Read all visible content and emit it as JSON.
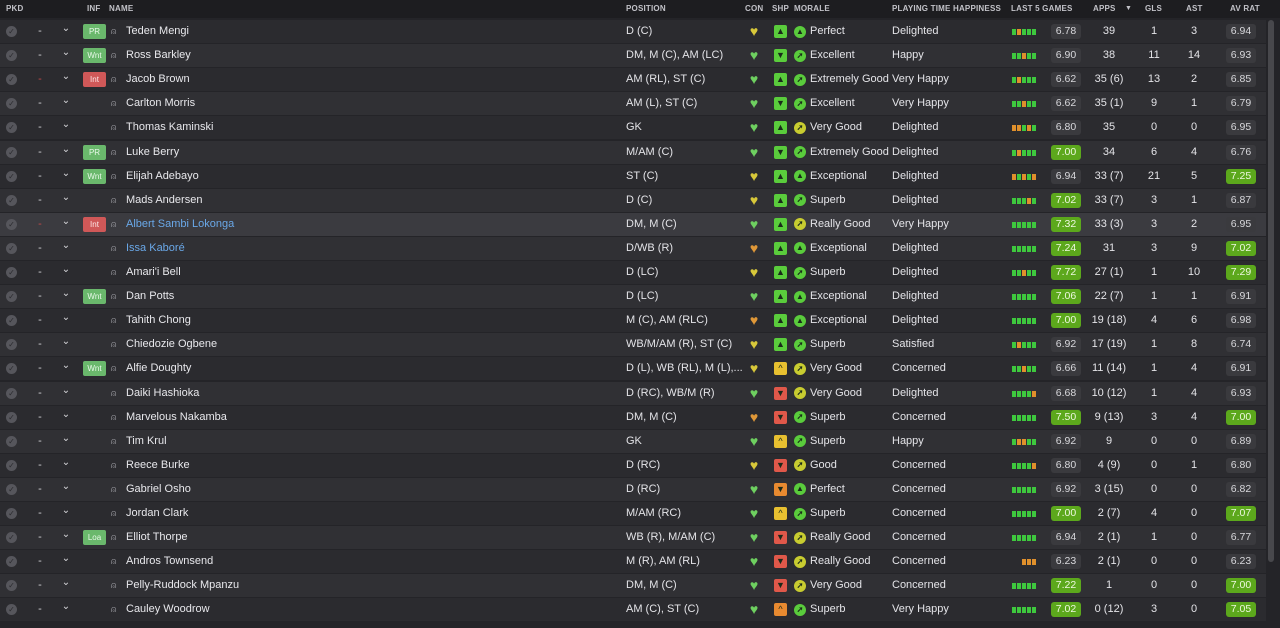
{
  "headers": {
    "pkd": "PKD",
    "inf": "INF",
    "name": "NAME",
    "position": "POSITION",
    "con": "CON",
    "shp": "SHP",
    "morale": "MORALE",
    "playing_time": "PLAYING TIME HAPPINESS",
    "last5": "LAST 5 GAMES",
    "apps": "APPS",
    "gls": "GLS",
    "ast": "AST",
    "avrat": "AV RAT",
    "sort_icon": "sort-desc-icon"
  },
  "colors": {
    "form_green": "#3ec83e",
    "form_orange": "#e0902c",
    "form_yellow": "#c8c844",
    "pill_green": "#5ca81c",
    "badge_green": "#6ab86c",
    "badge_red": "#d05858",
    "link_blue": "#6aa8e8",
    "heart_green": "#6ed060",
    "heart_yellow": "#d8c83a",
    "heart_orange": "#e09838",
    "shp_green": "#5acc3c",
    "shp_yellow": "#e8c030",
    "shp_orange": "#e88a30",
    "shp_red": "#e0584a",
    "morale_green": "#5acc3c",
    "morale_yellow": "#c8cc30"
  },
  "players": [
    {
      "dash": "-",
      "dash_red": false,
      "inf": "PR",
      "inf_color": "g",
      "name": "Teden Mengi",
      "link": false,
      "position": "D (C)",
      "con": "yellow",
      "shp": "green",
      "shp_icon": "up",
      "mor": "green",
      "mor_icon": "up",
      "morale": "Perfect",
      "pt": "Delighted",
      "form": [
        "g",
        "o",
        "g",
        "g",
        "g"
      ],
      "last5": "6.78",
      "last5_hi": false,
      "apps": "39",
      "gls": "1",
      "ast": "3",
      "avrat": "6.94",
      "avrat_hi": false
    },
    {
      "dash": "-",
      "dash_red": false,
      "inf": "Wnt",
      "inf_color": "g",
      "name": "Ross Barkley",
      "link": false,
      "position": "DM, M (C), AM (LC)",
      "con": "green",
      "shp": "green",
      "shp_icon": "down",
      "mor": "green",
      "mor_icon": "right",
      "morale": "Excellent",
      "pt": "Happy",
      "form": [
        "g",
        "g",
        "o",
        "g",
        "g"
      ],
      "last5": "6.90",
      "last5_hi": false,
      "apps": "38",
      "gls": "11",
      "ast": "14",
      "avrat": "6.93",
      "avrat_hi": false
    },
    {
      "dash": "-",
      "dash_red": true,
      "inf": "Int",
      "inf_color": "r",
      "name": "Jacob Brown",
      "link": false,
      "position": "AM (RL), ST (C)",
      "con": "green",
      "shp": "green",
      "shp_icon": "up",
      "mor": "green",
      "mor_icon": "right",
      "morale": "Extremely Good",
      "pt": "Very Happy",
      "form": [
        "g",
        "o",
        "g",
        "g",
        "g"
      ],
      "last5": "6.62",
      "last5_hi": false,
      "apps": "35 (6)",
      "gls": "13",
      "ast": "2",
      "avrat": "6.85",
      "avrat_hi": false
    },
    {
      "dash": "-",
      "dash_red": false,
      "inf": "",
      "inf_color": "",
      "name": "Carlton Morris",
      "link": false,
      "position": "AM (L), ST (C)",
      "con": "green",
      "shp": "green",
      "shp_icon": "down",
      "mor": "green",
      "mor_icon": "right",
      "morale": "Excellent",
      "pt": "Very Happy",
      "form": [
        "g",
        "g",
        "o",
        "g",
        "g"
      ],
      "last5": "6.62",
      "last5_hi": false,
      "apps": "35 (1)",
      "gls": "9",
      "ast": "1",
      "avrat": "6.79",
      "avrat_hi": false
    },
    {
      "dash": "-",
      "dash_red": false,
      "inf": "",
      "inf_color": "",
      "name": "Thomas Kaminski",
      "link": false,
      "position": "GK",
      "con": "green",
      "shp": "green",
      "shp_icon": "up",
      "mor": "yellow",
      "mor_icon": "right",
      "morale": "Very Good",
      "pt": "Delighted",
      "form": [
        "o",
        "o",
        "g",
        "o",
        "g"
      ],
      "last5": "6.80",
      "last5_hi": false,
      "apps": "35",
      "gls": "0",
      "ast": "0",
      "avrat": "6.95",
      "avrat_hi": false
    },
    {
      "dash": "-",
      "dash_red": false,
      "inf": "PR",
      "inf_color": "g",
      "name": "Luke Berry",
      "link": false,
      "position": "M/AM (C)",
      "con": "green",
      "shp": "green",
      "shp_icon": "down",
      "mor": "green",
      "mor_icon": "right",
      "morale": "Extremely Good",
      "pt": "Delighted",
      "form": [
        "g",
        "o",
        "g",
        "g",
        "g"
      ],
      "last5": "7.00",
      "last5_hi": true,
      "apps": "34",
      "gls": "6",
      "ast": "4",
      "avrat": "6.76",
      "avrat_hi": false
    },
    {
      "dash": "-",
      "dash_red": false,
      "inf": "Wnt",
      "inf_color": "g",
      "name": "Elijah Adebayo",
      "link": false,
      "position": "ST (C)",
      "con": "yellow",
      "shp": "green",
      "shp_icon": "up",
      "mor": "green",
      "mor_icon": "up",
      "morale": "Exceptional",
      "pt": "Delighted",
      "form": [
        "o",
        "g",
        "o",
        "g",
        "o"
      ],
      "last5": "6.94",
      "last5_hi": false,
      "apps": "33 (7)",
      "gls": "21",
      "ast": "5",
      "avrat": "7.25",
      "avrat_hi": true
    },
    {
      "dash": "-",
      "dash_red": false,
      "inf": "",
      "inf_color": "",
      "name": "Mads Andersen",
      "link": false,
      "position": "D (C)",
      "con": "yellow",
      "shp": "green",
      "shp_icon": "up",
      "mor": "green",
      "mor_icon": "right",
      "morale": "Superb",
      "pt": "Delighted",
      "form": [
        "g",
        "g",
        "g",
        "o",
        "g"
      ],
      "last5": "7.02",
      "last5_hi": true,
      "apps": "33 (7)",
      "gls": "3",
      "ast": "1",
      "avrat": "6.87",
      "avrat_hi": false
    },
    {
      "dash": "-",
      "dash_red": true,
      "inf": "Int",
      "inf_color": "r",
      "name": "Albert Sambi Lokonga",
      "link": true,
      "position": "DM, M (C)",
      "con": "green",
      "shp": "green",
      "shp_icon": "up",
      "mor": "yellow",
      "mor_icon": "right",
      "morale": "Really Good",
      "pt": "Very Happy",
      "form": [
        "g",
        "g",
        "g",
        "g",
        "g"
      ],
      "last5": "7.32",
      "last5_hi": true,
      "apps": "33 (3)",
      "gls": "3",
      "ast": "2",
      "avrat": "6.95",
      "avrat_hi": false
    },
    {
      "dash": "-",
      "dash_red": false,
      "inf": "",
      "inf_color": "",
      "name": "Issa Kaboré",
      "link": true,
      "position": "D/WB (R)",
      "con": "orange",
      "shp": "green",
      "shp_icon": "up",
      "mor": "green",
      "mor_icon": "up",
      "morale": "Exceptional",
      "pt": "Delighted",
      "form": [
        "g",
        "g",
        "g",
        "g",
        "g"
      ],
      "last5": "7.24",
      "last5_hi": true,
      "apps": "31",
      "gls": "3",
      "ast": "9",
      "avrat": "7.02",
      "avrat_hi": true
    },
    {
      "dash": "-",
      "dash_red": false,
      "inf": "",
      "inf_color": "",
      "name": "Amari'i Bell",
      "link": false,
      "position": "D (LC)",
      "con": "yellow",
      "shp": "green",
      "shp_icon": "up",
      "mor": "green",
      "mor_icon": "right",
      "morale": "Superb",
      "pt": "Delighted",
      "form": [
        "g",
        "g",
        "o",
        "g",
        "g"
      ],
      "last5": "7.72",
      "last5_hi": true,
      "apps": "27 (1)",
      "gls": "1",
      "ast": "10",
      "avrat": "7.29",
      "avrat_hi": true
    },
    {
      "dash": "-",
      "dash_red": false,
      "inf": "Wnt",
      "inf_color": "g",
      "name": "Dan Potts",
      "link": false,
      "position": "D (LC)",
      "con": "green",
      "shp": "green",
      "shp_icon": "up",
      "mor": "green",
      "mor_icon": "up",
      "morale": "Exceptional",
      "pt": "Delighted",
      "form": [
        "g",
        "g",
        "g",
        "g",
        "g"
      ],
      "last5": "7.06",
      "last5_hi": true,
      "apps": "22 (7)",
      "gls": "1",
      "ast": "1",
      "avrat": "6.91",
      "avrat_hi": false
    },
    {
      "dash": "-",
      "dash_red": false,
      "inf": "",
      "inf_color": "",
      "name": "Tahith Chong",
      "link": false,
      "position": "M (C), AM (RLC)",
      "con": "orange",
      "shp": "green",
      "shp_icon": "up",
      "mor": "green",
      "mor_icon": "up",
      "morale": "Exceptional",
      "pt": "Delighted",
      "form": [
        "g",
        "g",
        "g",
        "g",
        "g"
      ],
      "last5": "7.00",
      "last5_hi": true,
      "apps": "19 (18)",
      "gls": "4",
      "ast": "6",
      "avrat": "6.98",
      "avrat_hi": false
    },
    {
      "dash": "-",
      "dash_red": false,
      "inf": "",
      "inf_color": "",
      "name": "Chiedozie Ogbene",
      "link": false,
      "position": "WB/M/AM (R), ST (C)",
      "con": "yellow",
      "shp": "green",
      "shp_icon": "up",
      "mor": "green",
      "mor_icon": "right",
      "morale": "Superb",
      "pt": "Satisfied",
      "form": [
        "g",
        "o",
        "g",
        "g",
        "g"
      ],
      "last5": "6.92",
      "last5_hi": false,
      "apps": "17 (19)",
      "gls": "1",
      "ast": "8",
      "avrat": "6.74",
      "avrat_hi": false
    },
    {
      "dash": "-",
      "dash_red": false,
      "inf": "Wnt",
      "inf_color": "g",
      "name": "Alfie Doughty",
      "link": false,
      "position": "D (L), WB (RL), M (L),...",
      "con": "yellow",
      "shp": "yellow",
      "shp_icon": "caret",
      "mor": "yellow",
      "mor_icon": "right",
      "morale": "Very Good",
      "pt": "Concerned",
      "form": [
        "g",
        "g",
        "o",
        "g",
        "g"
      ],
      "last5": "6.66",
      "last5_hi": false,
      "apps": "11 (14)",
      "gls": "1",
      "ast": "4",
      "avrat": "6.91",
      "avrat_hi": false
    },
    {
      "dash": "-",
      "dash_red": false,
      "inf": "",
      "inf_color": "",
      "name": "Daiki Hashioka",
      "link": false,
      "position": "D (RC), WB/M (R)",
      "con": "green",
      "shp": "red",
      "shp_icon": "down",
      "mor": "yellow",
      "mor_icon": "right",
      "morale": "Very Good",
      "pt": "Delighted",
      "form": [
        "g",
        "g",
        "g",
        "g",
        "o"
      ],
      "last5": "6.68",
      "last5_hi": false,
      "apps": "10 (12)",
      "gls": "1",
      "ast": "4",
      "avrat": "6.93",
      "avrat_hi": false
    },
    {
      "dash": "-",
      "dash_red": false,
      "inf": "",
      "inf_color": "",
      "name": "Marvelous Nakamba",
      "link": false,
      "position": "DM, M (C)",
      "con": "orange",
      "shp": "red",
      "shp_icon": "down",
      "mor": "green",
      "mor_icon": "right",
      "morale": "Superb",
      "pt": "Concerned",
      "form": [
        "g",
        "g",
        "g",
        "g",
        "g"
      ],
      "last5": "7.50",
      "last5_hi": true,
      "apps": "9 (13)",
      "gls": "3",
      "ast": "4",
      "avrat": "7.00",
      "avrat_hi": true
    },
    {
      "dash": "-",
      "dash_red": false,
      "inf": "",
      "inf_color": "",
      "name": "Tim Krul",
      "link": false,
      "position": "GK",
      "con": "green",
      "shp": "yellow",
      "shp_icon": "caret",
      "mor": "green",
      "mor_icon": "right",
      "morale": "Superb",
      "pt": "Happy",
      "form": [
        "g",
        "o",
        "o",
        "g",
        "g"
      ],
      "last5": "6.92",
      "last5_hi": false,
      "apps": "9",
      "gls": "0",
      "ast": "0",
      "avrat": "6.89",
      "avrat_hi": false
    },
    {
      "dash": "-",
      "dash_red": false,
      "inf": "",
      "inf_color": "",
      "name": "Reece Burke",
      "link": false,
      "position": "D (RC)",
      "con": "yellow",
      "shp": "red",
      "shp_icon": "down",
      "mor": "yellow",
      "mor_icon": "right",
      "morale": "Good",
      "pt": "Concerned",
      "form": [
        "g",
        "g",
        "g",
        "g",
        "o"
      ],
      "last5": "6.80",
      "last5_hi": false,
      "apps": "4 (9)",
      "gls": "0",
      "ast": "1",
      "avrat": "6.80",
      "avrat_hi": false
    },
    {
      "dash": "-",
      "dash_red": false,
      "inf": "",
      "inf_color": "",
      "name": "Gabriel Osho",
      "link": false,
      "position": "D (RC)",
      "con": "green",
      "shp": "orange",
      "shp_icon": "down",
      "mor": "green",
      "mor_icon": "up",
      "morale": "Perfect",
      "pt": "Concerned",
      "form": [
        "g",
        "g",
        "g",
        "g",
        "g"
      ],
      "last5": "6.92",
      "last5_hi": false,
      "apps": "3 (15)",
      "gls": "0",
      "ast": "0",
      "avrat": "6.82",
      "avrat_hi": false
    },
    {
      "dash": "-",
      "dash_red": false,
      "inf": "",
      "inf_color": "",
      "name": "Jordan Clark",
      "link": false,
      "position": "M/AM (RC)",
      "con": "green",
      "shp": "yellow",
      "shp_icon": "caret",
      "mor": "green",
      "mor_icon": "right",
      "morale": "Superb",
      "pt": "Concerned",
      "form": [
        "g",
        "g",
        "g",
        "g",
        "g"
      ],
      "last5": "7.00",
      "last5_hi": true,
      "apps": "2 (7)",
      "gls": "4",
      "ast": "0",
      "avrat": "7.07",
      "avrat_hi": true
    },
    {
      "dash": "-",
      "dash_red": false,
      "inf": "Loa",
      "inf_color": "g",
      "name": "Elliot Thorpe",
      "link": false,
      "position": "WB (R), M/AM (C)",
      "con": "green",
      "shp": "red",
      "shp_icon": "down",
      "mor": "yellow",
      "mor_icon": "right",
      "morale": "Really Good",
      "pt": "Concerned",
      "form": [
        "g",
        "g",
        "g",
        "g",
        "g"
      ],
      "last5": "6.94",
      "last5_hi": false,
      "apps": "2 (1)",
      "gls": "1",
      "ast": "0",
      "avrat": "6.77",
      "avrat_hi": false
    },
    {
      "dash": "-",
      "dash_red": false,
      "inf": "",
      "inf_color": "",
      "name": "Andros Townsend",
      "link": false,
      "position": "M (R), AM (RL)",
      "con": "green",
      "shp": "red",
      "shp_icon": "down",
      "mor": "yellow",
      "mor_icon": "right",
      "morale": "Really Good",
      "pt": "Concerned",
      "form": [
        "o",
        "o",
        "o"
      ],
      "last5": "6.23",
      "last5_hi": false,
      "apps": "2 (1)",
      "gls": "0",
      "ast": "0",
      "avrat": "6.23",
      "avrat_hi": false
    },
    {
      "dash": "-",
      "dash_red": false,
      "inf": "",
      "inf_color": "",
      "name": "Pelly-Ruddock Mpanzu",
      "link": false,
      "position": "DM, M (C)",
      "con": "green",
      "shp": "red",
      "shp_icon": "down",
      "mor": "yellow",
      "mor_icon": "right",
      "morale": "Very Good",
      "pt": "Concerned",
      "form": [
        "g",
        "g",
        "g",
        "g",
        "g"
      ],
      "last5": "7.22",
      "last5_hi": true,
      "apps": "1",
      "gls": "0",
      "ast": "0",
      "avrat": "7.00",
      "avrat_hi": true
    },
    {
      "dash": "-",
      "dash_red": false,
      "inf": "",
      "inf_color": "",
      "name": "Cauley Woodrow",
      "link": false,
      "position": "AM (C), ST (C)",
      "con": "green",
      "shp": "orange",
      "shp_icon": "caret",
      "mor": "green",
      "mor_icon": "right",
      "morale": "Superb",
      "pt": "Very Happy",
      "form": [
        "g",
        "g",
        "g",
        "g",
        "g"
      ],
      "last5": "7.02",
      "last5_hi": true,
      "apps": "0 (12)",
      "gls": "3",
      "ast": "0",
      "avrat": "7.05",
      "avrat_hi": true
    }
  ]
}
